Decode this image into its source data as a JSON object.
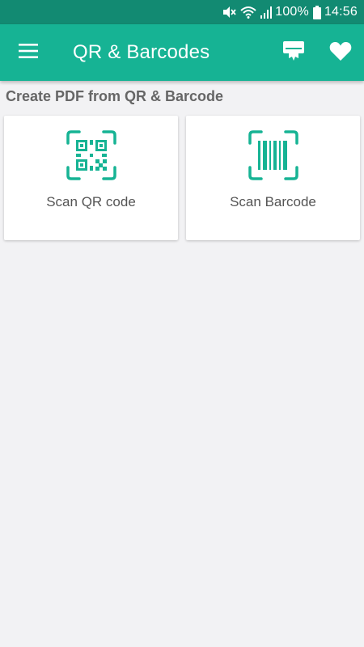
{
  "colors": {
    "status_bar": "#128a72",
    "app_bar": "#16b394",
    "accent": "#16b394",
    "background": "#f2f2f4"
  },
  "status_bar": {
    "battery_percent": "100%",
    "time": "14:56",
    "icons": [
      "mute-icon",
      "wifi-icon",
      "signal-icon",
      "battery-icon"
    ]
  },
  "app_bar": {
    "menu_icon": "hamburger-menu-icon",
    "title": "QR & Barcodes",
    "actions": [
      "pdf-print-icon",
      "heart-icon"
    ]
  },
  "main": {
    "section_title": "Create PDF from QR & Barcode",
    "cards": [
      {
        "label": "Scan QR code",
        "icon": "qr-code-scan-icon"
      },
      {
        "label": "Scan Barcode",
        "icon": "barcode-scan-icon"
      }
    ]
  }
}
